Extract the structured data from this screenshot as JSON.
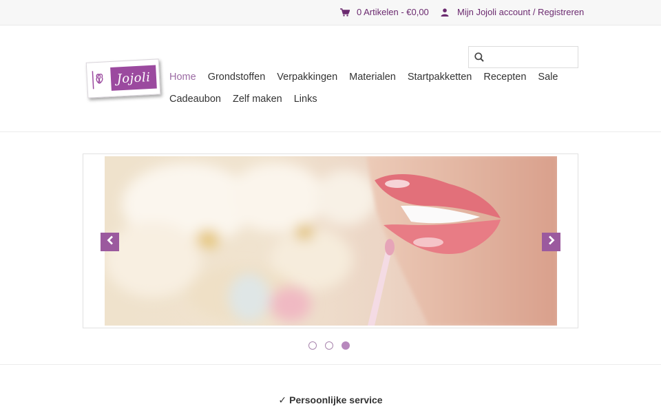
{
  "topbar": {
    "cart_label": "0 Artikelen - €0,00",
    "cart_icon": "shopping-cart-icon",
    "account_label": "Mijn Jojoli account / Registreren",
    "account_icon": "user-icon",
    "accent_color": "#6b2a6f"
  },
  "logo": {
    "wordmark": "Jojoli",
    "brand_color": "#9b4a9f"
  },
  "search": {
    "value": "",
    "placeholder": "",
    "icon": "search-icon"
  },
  "nav": {
    "items": [
      {
        "label": "Home",
        "active": true
      },
      {
        "label": "Grondstoffen"
      },
      {
        "label": "Verpakkingen"
      },
      {
        "label": "Materialen"
      },
      {
        "label": "Startpakketten"
      },
      {
        "label": "Recepten"
      },
      {
        "label": "Sale"
      },
      {
        "label": "Cadeaubon"
      },
      {
        "label": "Zelf maken"
      },
      {
        "label": "Links"
      }
    ],
    "active_color": "#9b6aa3"
  },
  "slider": {
    "prev_icon": "chevron-left-icon",
    "next_icon": "chevron-right-icon",
    "slide_count": 3,
    "active_slide": 3,
    "arrow_color": "#9b5a9e"
  },
  "usp": {
    "check": "✓",
    "text": "Persoonlijke service"
  }
}
